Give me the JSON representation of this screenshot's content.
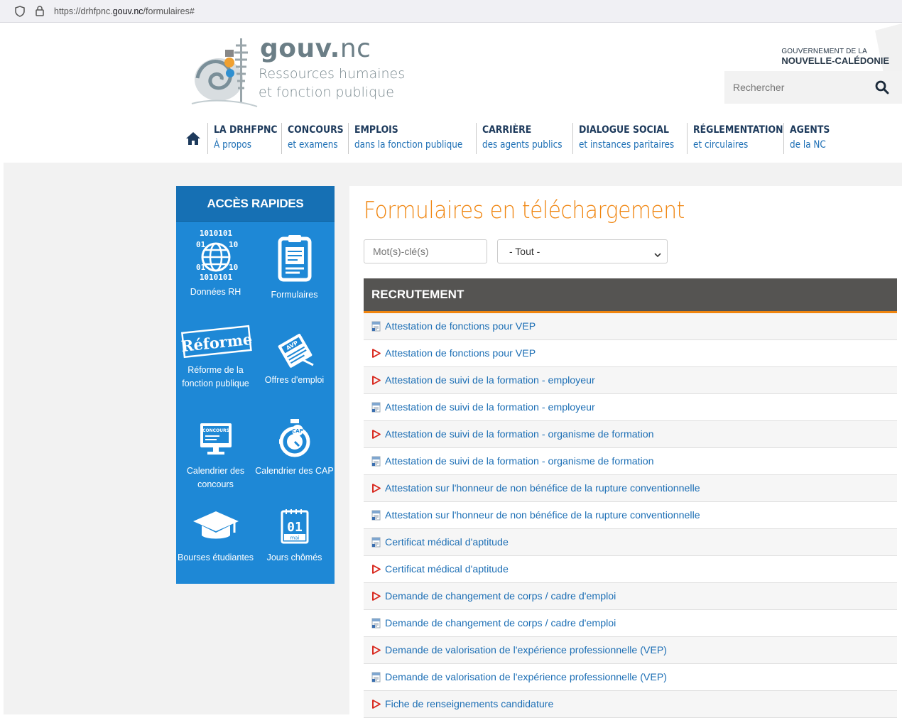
{
  "browser": {
    "url_prefix": "https://drhfpnc.",
    "url_domain": "gouv.nc",
    "url_suffix": "/formulaires#"
  },
  "header": {
    "brand_bold": "gouv.",
    "brand_light": "nc",
    "subtitle_line1": "Ressources humaines",
    "subtitle_line2": "et fonction publique",
    "gov_line1": "GOUVERNEMENT DE LA",
    "gov_line2": "NOUVELLE-CALÉDONIE",
    "search_placeholder": "Rechercher"
  },
  "nav": [
    {
      "title": "LA DRHFPNC",
      "sub": "À propos"
    },
    {
      "title": "CONCOURS",
      "sub": "et examens"
    },
    {
      "title": "EMPLOIS",
      "sub": "dans la fonction publique"
    },
    {
      "title": "CARRIÈRE",
      "sub": "des agents publics"
    },
    {
      "title": "DIALOGUE SOCIAL",
      "sub": "et instances paritaires"
    },
    {
      "title": "RÉGLEMENTATION",
      "sub": "et circulaires"
    },
    {
      "title": "AGENTS",
      "sub": "de la NC"
    }
  ],
  "sidebar": {
    "title": "ACCÈS RAPIDES",
    "tiles": [
      {
        "label": "Données RH",
        "icon": "globe-binary-icon"
      },
      {
        "label": "Formulaires",
        "icon": "clipboard-icon"
      },
      {
        "label": "Réforme de la fonction publique",
        "icon": "reforme-stamp-icon",
        "stamp_text": "Réforme"
      },
      {
        "label": "Offres d'emploi",
        "icon": "newspaper-icon",
        "badge": "AVP"
      },
      {
        "label": "Calendrier des concours",
        "icon": "monitor-concours-icon",
        "badge": "CONCOURS"
      },
      {
        "label": "Calendrier des CAP",
        "icon": "stopwatch-icon",
        "badge": "CAP"
      },
      {
        "label": "Bourses étudiantes",
        "icon": "graduation-cap-icon"
      },
      {
        "label": "Jours chômés",
        "icon": "calendar-icon",
        "day": "01",
        "month": "mai"
      }
    ]
  },
  "main": {
    "title": "Formulaires en téléchargement",
    "keyword_placeholder": "Mot(s)-clé(s)",
    "category_selected": "- Tout -",
    "section_title": "RECRUTEMENT",
    "files": [
      {
        "type": "doc",
        "label": "Attestation de fonctions pour VEP"
      },
      {
        "type": "pdf",
        "label": "Attestation de fonctions pour VEP"
      },
      {
        "type": "pdf",
        "label": "Attestation de suivi de la formation - employeur"
      },
      {
        "type": "doc",
        "label": "Attestation de suivi de la formation - employeur"
      },
      {
        "type": "pdf",
        "label": "Attestation de suivi de la formation - organisme de formation"
      },
      {
        "type": "doc",
        "label": "Attestation de suivi de la formation - organisme de formation"
      },
      {
        "type": "pdf",
        "label": "Attestation sur l'honneur de non bénéfice de la rupture conventionnelle"
      },
      {
        "type": "doc",
        "label": "Attestation sur l'honneur de non bénéfice de la rupture conventionnelle"
      },
      {
        "type": "doc",
        "label": "Certificat médical d'aptitude"
      },
      {
        "type": "pdf",
        "label": "Certificat médical d'aptitude"
      },
      {
        "type": "pdf",
        "label": "Demande de changement de corps / cadre d'emploi"
      },
      {
        "type": "doc",
        "label": "Demande de changement de corps / cadre d'emploi"
      },
      {
        "type": "pdf",
        "label": "Demande de valorisation de l'expérience professionnelle (VEP)"
      },
      {
        "type": "doc",
        "label": "Demande de valorisation de l'expérience professionnelle (VEP)"
      },
      {
        "type": "pdf",
        "label": "Fiche de renseignements candidature"
      }
    ]
  }
}
